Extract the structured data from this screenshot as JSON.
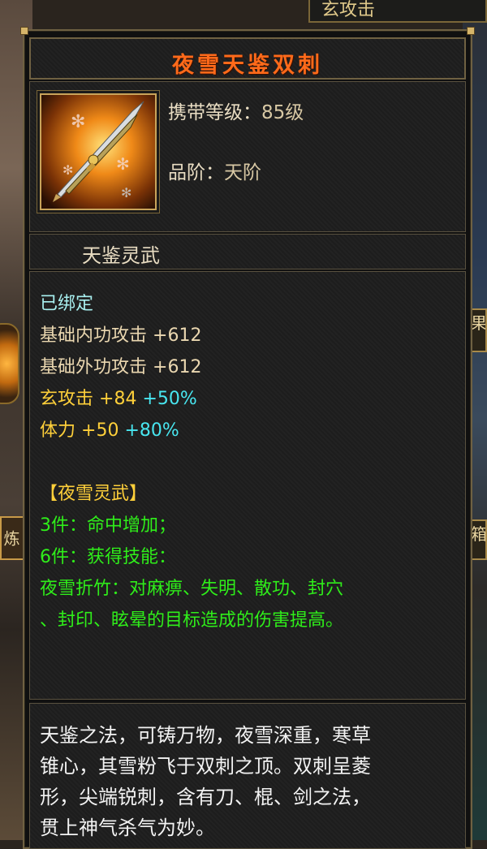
{
  "background": {
    "top_label": "玄攻击",
    "left_tag": "炼",
    "right_tag_1": "果",
    "right_tag_2": "箱"
  },
  "item": {
    "name": "夜雪天鉴双刺",
    "name_color": "#ff6a1a",
    "icon": "double-spike-weapon-icon",
    "level_label": "携带等级：",
    "level_value": "85级",
    "grade_label": "品阶：",
    "grade_value": "天阶",
    "series_name": "天鉴灵武"
  },
  "stats": {
    "bound": "已绑定",
    "inner_attack_label": "基础内功攻击",
    "inner_attack_value": "+612",
    "outer_attack_label": "基础外功攻击",
    "outer_attack_value": "+612",
    "mystic_attack_label": "玄攻击",
    "mystic_attack_value": "+84",
    "mystic_attack_bonus": "+50%",
    "stamina_label": "体力",
    "stamina_value": "+50",
    "stamina_bonus": "+80%"
  },
  "set_bonus": {
    "set_title": "【夜雪灵武】",
    "piece3": "3件：命中增加；",
    "piece6": "6件：获得技能：",
    "skill_line1": "夜雪折竹：对麻痹、失明、散功、封穴",
    "skill_line2": "、封印、眩晕的目标造成的伤害提高。"
  },
  "description": {
    "line1": "天鉴之法，可铸万物，夜雪深重，寒草",
    "line2": "锥心，其雪粉飞于双刺之顶。双刺呈菱",
    "line3": "形，尖端锐刺，含有刀、棍、剑之法，",
    "line4": "贯上神气杀气为妙。"
  },
  "colors": {
    "bound": "#a8f0f0",
    "base_stat": "#ead7b0",
    "yellow_stat": "#ffd03a",
    "bonus": "#48e6f0",
    "set_text": "#2fee1a",
    "description": "#f2f2f2"
  }
}
